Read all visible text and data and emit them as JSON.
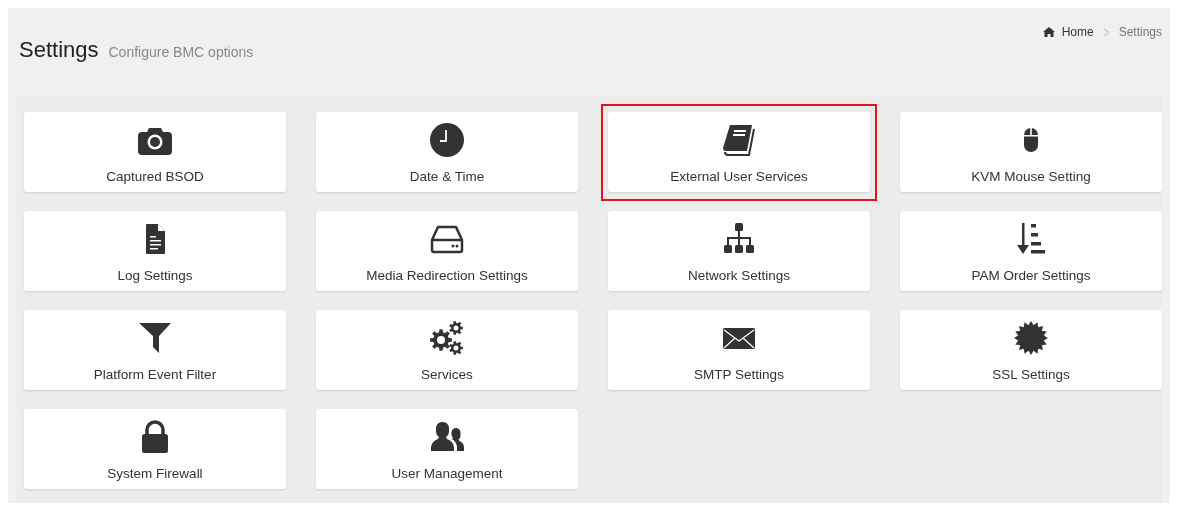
{
  "header": {
    "title": "Settings",
    "subtitle": "Configure BMC options"
  },
  "breadcrumb": [
    {
      "label": "Home"
    },
    {
      "label": "Settings"
    }
  ],
  "tiles": [
    {
      "label": "Captured BSOD",
      "kind": "camera",
      "highlighted": false
    },
    {
      "label": "Date & Time",
      "kind": "clock",
      "highlighted": false
    },
    {
      "label": "External User Services",
      "kind": "book",
      "highlighted": true
    },
    {
      "label": "KVM Mouse Setting",
      "kind": "mouse",
      "highlighted": false
    },
    {
      "label": "Log Settings",
      "kind": "file",
      "highlighted": false
    },
    {
      "label": "Media Redirection Settings",
      "kind": "drive",
      "highlighted": false
    },
    {
      "label": "Network Settings",
      "kind": "sitemap",
      "highlighted": false
    },
    {
      "label": "PAM Order Settings",
      "kind": "sort",
      "highlighted": false
    },
    {
      "label": "Platform Event Filter",
      "kind": "filter",
      "highlighted": false
    },
    {
      "label": "Services",
      "kind": "gears",
      "highlighted": false
    },
    {
      "label": "SMTP Settings",
      "kind": "envelope",
      "highlighted": false
    },
    {
      "label": "SSL Settings",
      "kind": "seal",
      "highlighted": false
    },
    {
      "label": "System Firewall",
      "kind": "lock",
      "highlighted": false
    },
    {
      "label": "User Management",
      "kind": "users",
      "highlighted": false
    }
  ]
}
